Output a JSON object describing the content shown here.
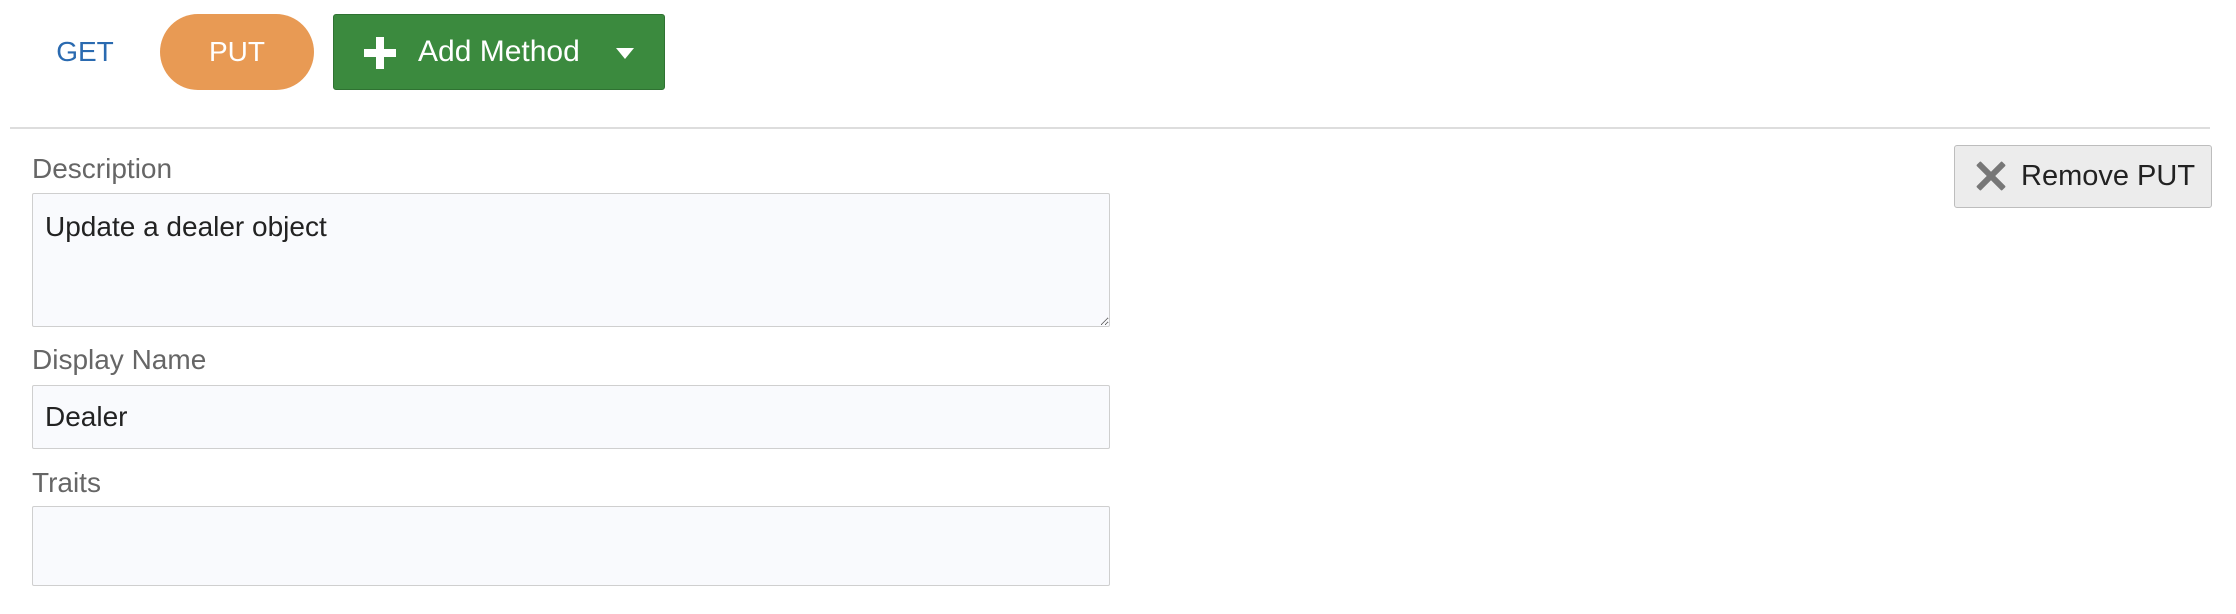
{
  "methods": {
    "tabs": [
      {
        "label": "GET",
        "active": false
      },
      {
        "label": "PUT",
        "active": true
      }
    ],
    "add_method": {
      "label": "Add Method",
      "icon": "plus-icon",
      "dropdown_icon": "caret-down-icon"
    }
  },
  "remove_button": {
    "label": "Remove PUT",
    "icon": "close-icon"
  },
  "form": {
    "description": {
      "label": "Description",
      "value": "Update a dealer object"
    },
    "display_name": {
      "label": "Display Name",
      "value": "Dealer"
    },
    "traits": {
      "label": "Traits",
      "value": ""
    }
  },
  "colors": {
    "active_tab": "#e89a54",
    "link": "#2a6ab0",
    "primary_button": "#3b8a3e"
  }
}
